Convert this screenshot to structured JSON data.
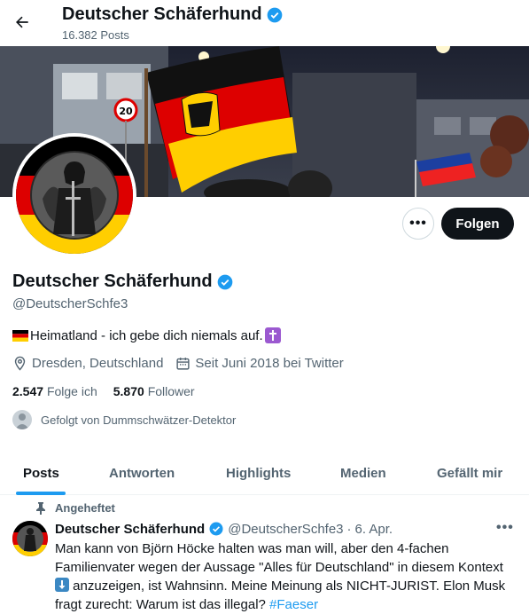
{
  "header": {
    "title": "Deutscher Schäferhund",
    "post_count": "16.382 Posts"
  },
  "profile": {
    "name": "Deutscher Schäferhund",
    "handle": "@DeutscherSchfe3",
    "bio_text": "Heimatland - ich gebe dich niemals auf.",
    "location": "Dresden, Deutschland",
    "joined": "Seit Juni 2018 bei Twitter",
    "following_count": "2.547",
    "following_label": "Folge ich",
    "followers_count": "5.870",
    "followers_label": "Follower",
    "followed_by": "Gefolgt von Dummschwätzer-Detektor"
  },
  "actions": {
    "more_label": "•••",
    "follow_label": "Folgen"
  },
  "tabs": [
    {
      "label": "Posts"
    },
    {
      "label": "Antworten"
    },
    {
      "label": "Highlights"
    },
    {
      "label": "Medien"
    },
    {
      "label": "Gefällt mir"
    }
  ],
  "tweet": {
    "pinned_label": "Angeheftet",
    "name": "Deutscher Schäferhund",
    "handle": "@DeutscherSchfe3",
    "separator": "·",
    "date": "6. Apr.",
    "more_label": "•••",
    "text_part1": "Man kann von Björn Höcke halten was man will, aber den 4-fachen Familienvater wegen der Aussage \"Alles für Deutschland\" in diesem Kontext",
    "text_part2": " anzuzeigen, ist Wahnsinn. Meine Meinung als NICHT-JURIST.  Elon Musk fragt zurecht: Warum ist das illegal? ",
    "hashtag": "#Faeser"
  },
  "colors": {
    "accent": "#1d9bf0",
    "text": "#0f1419",
    "secondary": "#536471",
    "verified": "#1d9bf0",
    "flag_black": "#000000",
    "flag_red": "#dd0000",
    "flag_gold": "#ffce00"
  },
  "icons": {
    "back": "arrow-left-icon",
    "verified": "verified-badge-icon",
    "location": "location-pin-icon",
    "calendar": "calendar-icon",
    "pin": "pin-icon",
    "more": "more-horizontal-icon"
  }
}
